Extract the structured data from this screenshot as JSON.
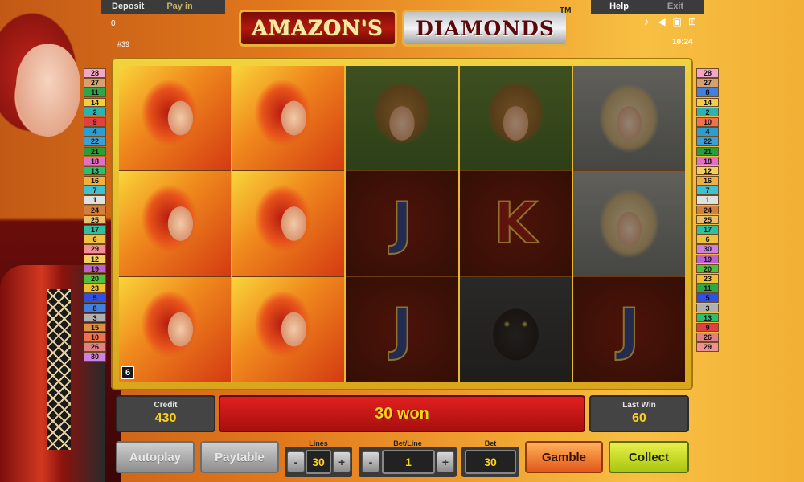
{
  "topbar": {
    "deposit_label": "Deposit",
    "payin_label": "Pay in",
    "help_label": "Help",
    "exit_label": "Exit"
  },
  "session": {
    "credit_small": "0",
    "game_id": "#39",
    "clock": "10:24"
  },
  "title": {
    "part1": "AMAZON'S",
    "part2": "DIAMONDS",
    "tm": "TM"
  },
  "tools": [
    "music-icon",
    "sound-icon",
    "fullscreen-icon",
    "settings-icon"
  ],
  "line_markers_left": [
    {
      "n": "28",
      "c": "#f2a6c8"
    },
    {
      "n": "27",
      "c": "#d6a070"
    },
    {
      "n": "11",
      "c": "#2aa84a"
    },
    {
      "n": "14",
      "c": "#f0d040"
    },
    {
      "n": "2",
      "c": "#2bb3b3"
    },
    {
      "n": "9",
      "c": "#e04040"
    },
    {
      "n": "4",
      "c": "#2b9ed0"
    },
    {
      "n": "22",
      "c": "#3aa0d8"
    },
    {
      "n": "21",
      "c": "#2a9e3a"
    },
    {
      "n": "18",
      "c": "#e070c0"
    },
    {
      "n": "13",
      "c": "#2ac070"
    },
    {
      "n": "16",
      "c": "#f0b040"
    },
    {
      "n": "7",
      "c": "#40c0d0"
    },
    {
      "n": "1",
      "c": "#e0e0e0"
    },
    {
      "n": "24",
      "c": "#d08040"
    },
    {
      "n": "25",
      "c": "#e8c070"
    },
    {
      "n": "17",
      "c": "#30c0a0"
    },
    {
      "n": "6",
      "c": "#f0c040"
    },
    {
      "n": "29",
      "c": "#f09090"
    },
    {
      "n": "12",
      "c": "#f0d060"
    },
    {
      "n": "19",
      "c": "#c060d0"
    },
    {
      "n": "20",
      "c": "#50c040"
    },
    {
      "n": "23",
      "c": "#f0c030"
    },
    {
      "n": "5",
      "c": "#3050e0"
    },
    {
      "n": "8",
      "c": "#4080e0"
    },
    {
      "n": "3",
      "c": "#b0b0b0"
    },
    {
      "n": "15",
      "c": "#e09040"
    },
    {
      "n": "10",
      "c": "#f07050"
    },
    {
      "n": "26",
      "c": "#e08080"
    },
    {
      "n": "30",
      "c": "#d080e0"
    }
  ],
  "line_markers_right": [
    {
      "n": "28",
      "c": "#f2a6c8"
    },
    {
      "n": "27",
      "c": "#d6a070"
    },
    {
      "n": "8",
      "c": "#4080e0"
    },
    {
      "n": "14",
      "c": "#f0d040"
    },
    {
      "n": "2",
      "c": "#2bb3b3"
    },
    {
      "n": "10",
      "c": "#f07050"
    },
    {
      "n": "4",
      "c": "#2b9ed0"
    },
    {
      "n": "22",
      "c": "#3aa0d8"
    },
    {
      "n": "21",
      "c": "#2a9e3a"
    },
    {
      "n": "18",
      "c": "#e070c0"
    },
    {
      "n": "12",
      "c": "#f0d060"
    },
    {
      "n": "16",
      "c": "#f0b040"
    },
    {
      "n": "7",
      "c": "#40c0d0"
    },
    {
      "n": "1",
      "c": "#e0e0e0"
    },
    {
      "n": "24",
      "c": "#d08040"
    },
    {
      "n": "25",
      "c": "#e8c070"
    },
    {
      "n": "17",
      "c": "#30c0a0"
    },
    {
      "n": "6",
      "c": "#f0c040"
    },
    {
      "n": "30",
      "c": "#d080e0"
    },
    {
      "n": "19",
      "c": "#c060d0"
    },
    {
      "n": "20",
      "c": "#50c040"
    },
    {
      "n": "23",
      "c": "#f0c030"
    },
    {
      "n": "11",
      "c": "#2aa84a"
    },
    {
      "n": "5",
      "c": "#3050e0"
    },
    {
      "n": "3",
      "c": "#b0b0b0"
    },
    {
      "n": "13",
      "c": "#2ac070"
    },
    {
      "n": "9",
      "c": "#e04040"
    },
    {
      "n": "26",
      "c": "#e08080"
    },
    {
      "n": "29",
      "c": "#f09090"
    }
  ],
  "reels": [
    {
      "cells": [
        {
          "sym": "amazon",
          "win": true
        },
        {
          "sym": "amazon",
          "win": true
        },
        {
          "sym": "amazon",
          "win": true,
          "badge": "6"
        }
      ]
    },
    {
      "cells": [
        {
          "sym": "amazon",
          "win": true
        },
        {
          "sym": "amazon",
          "win": true
        },
        {
          "sym": "amazon",
          "win": true
        }
      ]
    },
    {
      "cells": [
        {
          "sym": "flower",
          "win": false
        },
        {
          "sym": "J",
          "win": false
        },
        {
          "sym": "J",
          "win": false
        }
      ]
    },
    {
      "cells": [
        {
          "sym": "flower",
          "win": false
        },
        {
          "sym": "K",
          "win": false
        },
        {
          "sym": "panther",
          "win": false
        }
      ]
    },
    {
      "cells": [
        {
          "sym": "blonde",
          "win": false
        },
        {
          "sym": "blonde",
          "win": false
        },
        {
          "sym": "J",
          "win": false
        }
      ]
    }
  ],
  "panels": {
    "credit_label": "Credit",
    "credit_value": "430",
    "message": "30 won",
    "lastwin_label": "Last Win",
    "lastwin_value": "60"
  },
  "controls": {
    "autoplay_label": "Autoplay",
    "paytable_label": "Paytable",
    "lines_label": "Lines",
    "lines_value": "30",
    "betline_label": "Bet/Line",
    "betline_value": "1",
    "bet_label": "Bet",
    "bet_value": "30",
    "minus": "-",
    "plus": "+",
    "gamble_label": "Gamble",
    "collect_label": "Collect"
  }
}
